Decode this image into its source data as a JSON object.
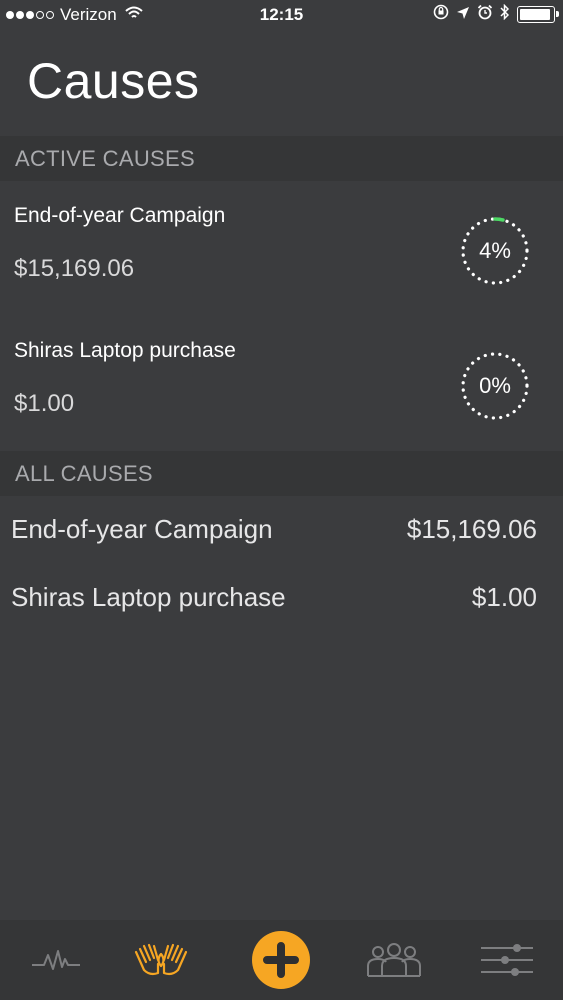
{
  "status_bar": {
    "carrier": "Verizon",
    "time": "12:15",
    "signal_bars_filled": 3,
    "signal_bars_total": 5
  },
  "page": {
    "title": "Causes"
  },
  "active_causes": {
    "header": "ACTIVE CAUSES",
    "items": [
      {
        "name": "End-of-year Campaign",
        "amount": "$15,169.06",
        "progress_label": "4%",
        "progress": 0.04
      },
      {
        "name": "Shiras Laptop purchase",
        "amount": "$1.00",
        "progress_label": "0%",
        "progress": 0.0
      }
    ]
  },
  "all_causes": {
    "header": "ALL CAUSES",
    "items": [
      {
        "name": "End-of-year Campaign",
        "amount": "$15,169.06"
      },
      {
        "name": "Shiras Laptop purchase",
        "amount": "$1.00"
      }
    ]
  },
  "tab_bar": {
    "tabs": [
      {
        "icon": "activity-pulse-icon",
        "active": false
      },
      {
        "icon": "giving-hands-icon",
        "active": true
      },
      {
        "icon": "add-icon",
        "active": false
      },
      {
        "icon": "people-group-icon",
        "active": false
      },
      {
        "icon": "settings-sliders-icon",
        "active": false
      }
    ]
  },
  "colors": {
    "background": "#3b3c3e",
    "section_header_bg": "#353637",
    "accent": "#f6a623",
    "progress_green": "#4cd964",
    "inactive_icon": "#7d7e80"
  }
}
